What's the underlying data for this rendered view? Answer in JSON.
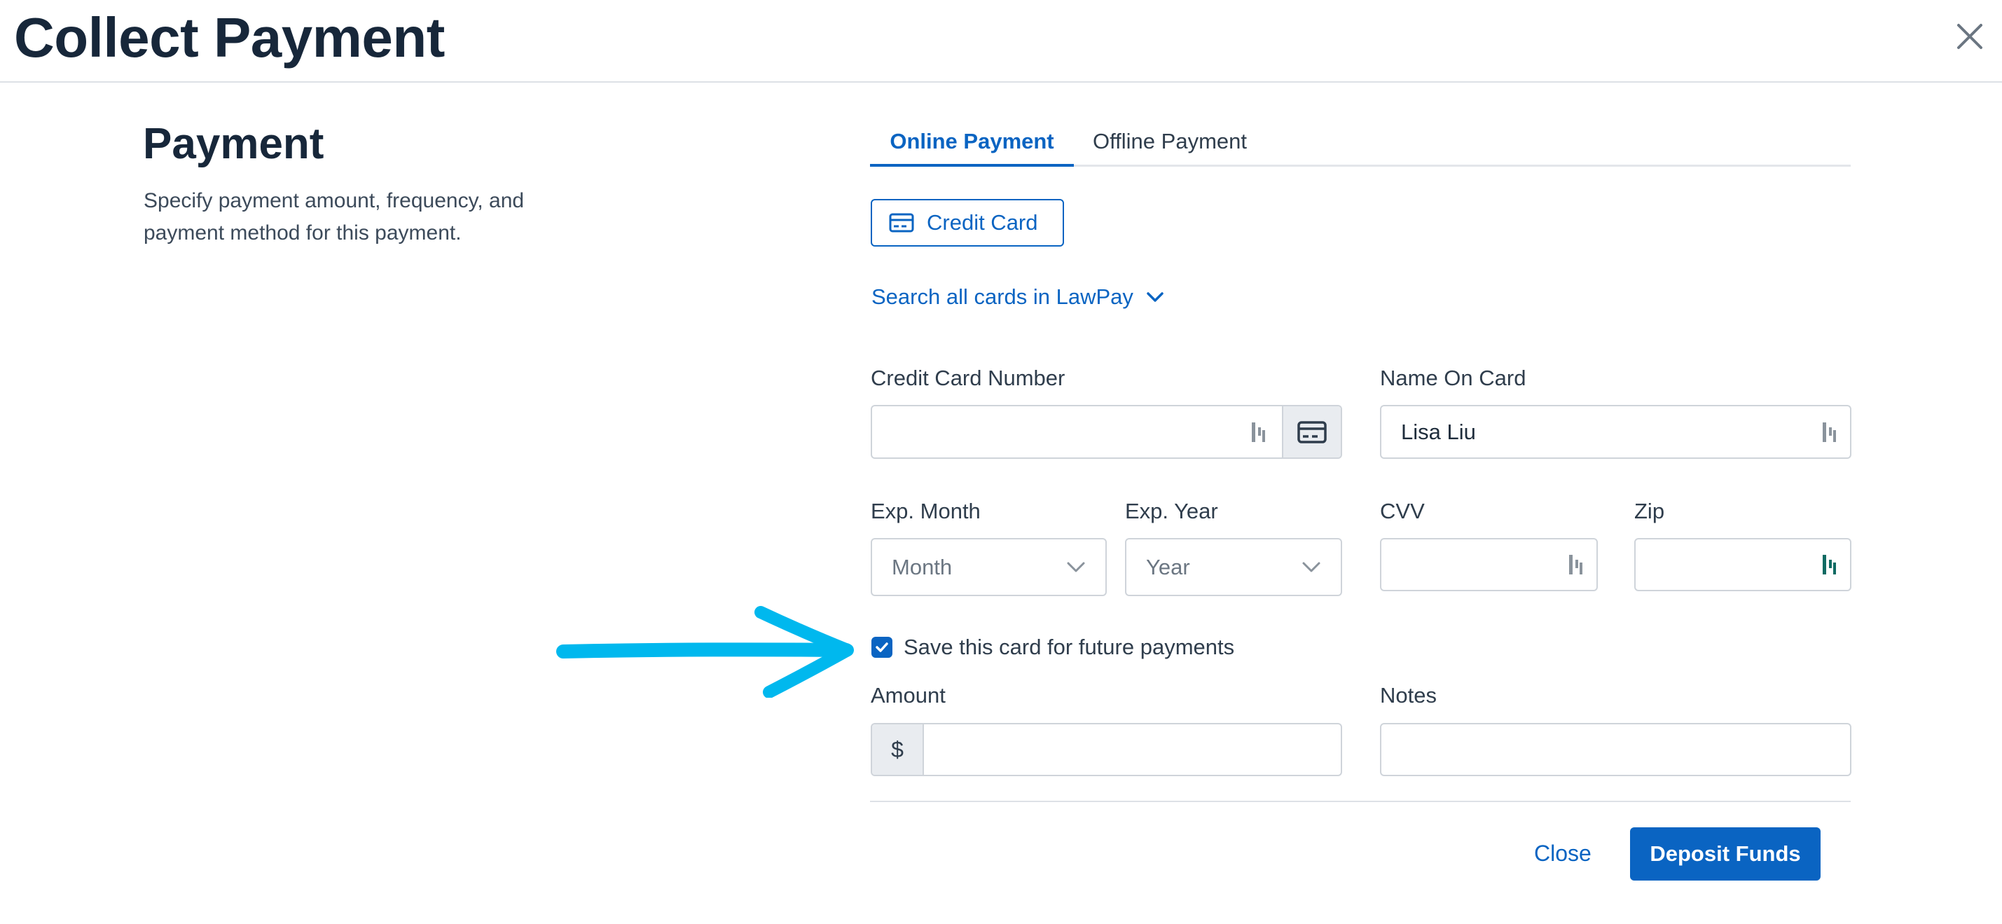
{
  "header": {
    "title": "Collect Payment"
  },
  "section": {
    "title": "Payment",
    "description": "Specify payment amount, frequency, and payment method for this payment."
  },
  "tabs": [
    {
      "label": "Online Payment",
      "active": true
    },
    {
      "label": "Offline Payment",
      "active": false
    }
  ],
  "method_button": {
    "label": "Credit Card",
    "icon": "credit-card-icon"
  },
  "search_link": {
    "label": "Search all cards in LawPay",
    "icon": "chevron-down-icon"
  },
  "fields": {
    "card_number": {
      "label": "Credit Card Number",
      "value": ""
    },
    "name_on_card": {
      "label": "Name On Card",
      "value": "Lisa Liu"
    },
    "exp_month": {
      "label": "Exp. Month",
      "placeholder": "Month"
    },
    "exp_year": {
      "label": "Exp. Year",
      "placeholder": "Year"
    },
    "cvv": {
      "label": "CVV",
      "value": ""
    },
    "zip": {
      "label": "Zip",
      "value": ""
    },
    "amount": {
      "label": "Amount",
      "prefix": "$",
      "value": ""
    },
    "notes": {
      "label": "Notes",
      "value": ""
    }
  },
  "save_card": {
    "label": "Save this card for future payments",
    "checked": true
  },
  "footer": {
    "close_label": "Close",
    "deposit_label": "Deposit Funds"
  },
  "colors": {
    "accent": "#0a64c2",
    "annotation_arrow": "#00b8ee",
    "title": "#17273a"
  }
}
